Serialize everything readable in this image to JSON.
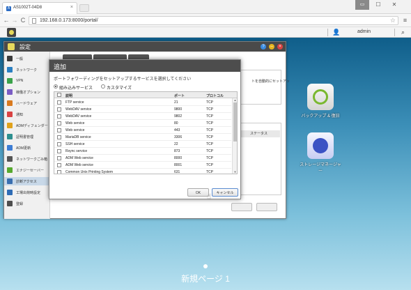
{
  "browser": {
    "tab_title": "AS1002T-04D8",
    "url": "192.168.0.173:8000/portal/",
    "win_min": "▭",
    "win_max": "☐",
    "win_close": "✕",
    "back": "←",
    "forward": "→",
    "reload": "C",
    "star": "☆",
    "menu": "≡"
  },
  "adm": {
    "username": "admin",
    "user_icon": "user-icon",
    "search_icon": "search-icon"
  },
  "desktop": {
    "apps": [
      {
        "label": "バックアップ & 復旧",
        "icon": "backup-restore-icon"
      },
      {
        "label": "ストレージマネージャー",
        "icon": "storage-manager-icon"
      }
    ],
    "page_name": "新規ページ 1"
  },
  "settings": {
    "title": "設定",
    "sidebar": [
      {
        "label": "一般",
        "color": "#3c3c3c"
      },
      {
        "label": "ネットワーク",
        "color": "#2a7fc1"
      },
      {
        "label": "VPN",
        "color": "#3aa24a"
      },
      {
        "label": "稼働オプション",
        "color": "#7a5cc4"
      },
      {
        "label": "ハードウェア",
        "color": "#d97a1f"
      },
      {
        "label": "通知",
        "color": "#d94343"
      },
      {
        "label": "ADMディフェンダー",
        "color": "#e0a21c"
      },
      {
        "label": "証明書管理",
        "color": "#2d8f8f"
      },
      {
        "label": "ADM更新",
        "color": "#3d7dd4"
      },
      {
        "label": "ネットワークごみ箱",
        "color": "#555555"
      },
      {
        "label": "エナジーセーバー",
        "color": "#57a92f"
      },
      {
        "label": "診断アクセス",
        "color": "#3a6fb0"
      },
      {
        "label": "工場出荷時設定",
        "color": "#2f6cb5"
      },
      {
        "label": "登録",
        "color": "#4e4e4e"
      }
    ],
    "active_item": "診断アクセス",
    "status_header": "ステータス",
    "auto_note": "トを自動的にセットアッ"
  },
  "modal": {
    "title": "追加",
    "description": "ポートフォワーディングをセットアップするサービスを選択してください",
    "options": [
      {
        "label": "組み込みサービス",
        "selected": true
      },
      {
        "label": "カスタマイズ",
        "selected": false
      }
    ],
    "columns": [
      "説明",
      "ポート",
      "プロトコル"
    ],
    "rows": [
      {
        "desc": "FTP service",
        "port": "21",
        "proto": "TCP"
      },
      {
        "desc": "WebDAV service",
        "port": "9800",
        "proto": "TCP"
      },
      {
        "desc": "WebDAV service",
        "port": "9802",
        "proto": "TCP"
      },
      {
        "desc": "Web service",
        "port": "80",
        "proto": "TCP"
      },
      {
        "desc": "Web service",
        "port": "443",
        "proto": "TCP"
      },
      {
        "desc": "MariaDB service",
        "port": "3306",
        "proto": "TCP"
      },
      {
        "desc": "SSH service",
        "port": "22",
        "proto": "TCP"
      },
      {
        "desc": "Rsync service",
        "port": "873",
        "proto": "TCP"
      },
      {
        "desc": "ADM Web service",
        "port": "8000",
        "proto": "TCP"
      },
      {
        "desc": "ADM Web service",
        "port": "8001",
        "proto": "TCP"
      },
      {
        "desc": "Common Unix Printing System",
        "port": "631",
        "proto": "TCP"
      }
    ],
    "ok_label": "OK",
    "cancel_label": "キャンセル"
  }
}
